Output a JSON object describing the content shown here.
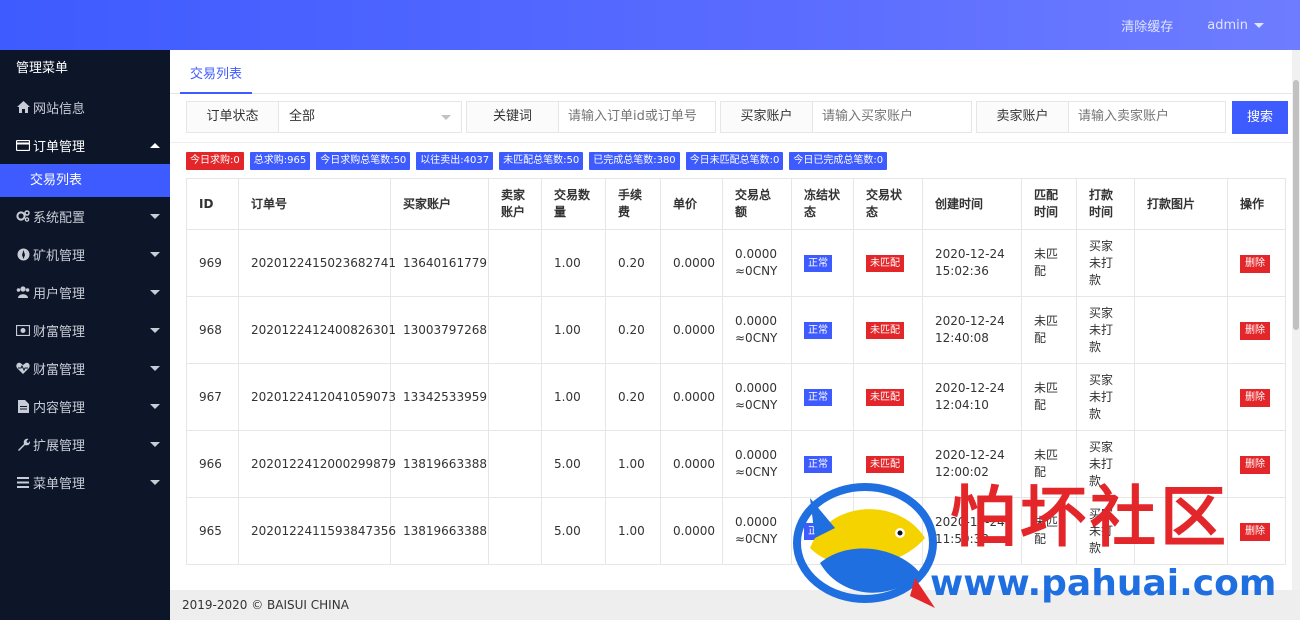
{
  "header": {
    "clear_cache": "清除缓存",
    "user": "admin"
  },
  "sidebar": {
    "title": "管理菜单",
    "items": [
      {
        "label": "网站信息",
        "icon": "home-icon"
      },
      {
        "label": "订单管理",
        "icon": "card-icon"
      },
      {
        "label": "系统配置",
        "icon": "gears-icon"
      },
      {
        "label": "矿机管理",
        "icon": "jet-icon"
      },
      {
        "label": "用户管理",
        "icon": "users-icon"
      },
      {
        "label": "财富管理",
        "icon": "money-icon"
      },
      {
        "label": "财富管理",
        "icon": "heartbeat-icon"
      },
      {
        "label": "内容管理",
        "icon": "file-icon"
      },
      {
        "label": "扩展管理",
        "icon": "wrench-icon"
      },
      {
        "label": "菜单管理",
        "icon": "bars-icon"
      }
    ],
    "sub_item": "交易列表"
  },
  "tab": "交易列表",
  "search": {
    "status_label": "订单状态",
    "status_value": "全部",
    "keyword_label": "关键词",
    "keyword_placeholder": "请输入订单id或订单号",
    "buyer_label": "买家账户",
    "buyer_placeholder": "请输入买家账户",
    "seller_label": "卖家账户",
    "seller_placeholder": "请输入卖家账户",
    "button": "搜索"
  },
  "badges": [
    {
      "text": "今日求购:0",
      "color": "#e3262a"
    },
    {
      "text": "总求购:965",
      "color": "#3e5bff"
    },
    {
      "text": "今日求购总笔数:50",
      "color": "#3e5bff"
    },
    {
      "text": "以往卖出:4037",
      "color": "#3e5bff"
    },
    {
      "text": "未匹配总笔数:50",
      "color": "#3e5bff"
    },
    {
      "text": "已完成总笔数:380",
      "color": "#3e5bff"
    },
    {
      "text": "今日未匹配总笔数:0",
      "color": "#3e5bff"
    },
    {
      "text": "今日已完成总笔数:0",
      "color": "#3e5bff"
    }
  ],
  "table": {
    "headers": [
      "ID",
      "订单号",
      "买家账户",
      "卖家账户",
      "交易数量",
      "手续费",
      "单价",
      "交易总额",
      "冻结状态",
      "交易状态",
      "创建时间",
      "匹配时间",
      "打款时间",
      "打款图片",
      "操作"
    ],
    "rows": [
      {
        "id": "969",
        "order": "2020122415023682741",
        "buyer": "13640161779",
        "seller": "",
        "qty": "1.00",
        "fee": "0.20",
        "price": "0.0000",
        "total1": "0.0000",
        "total2": "≈0CNY",
        "freeze": "正常",
        "status": "未匹配",
        "date": "2020-12-24",
        "time": "15:02:36",
        "match": "未匹配",
        "pay": "买家未打款",
        "img": "",
        "op": "删除"
      },
      {
        "id": "968",
        "order": "2020122412400826301",
        "buyer": "13003797268",
        "seller": "",
        "qty": "1.00",
        "fee": "0.20",
        "price": "0.0000",
        "total1": "0.0000",
        "total2": "≈0CNY",
        "freeze": "正常",
        "status": "未匹配",
        "date": "2020-12-24",
        "time": "12:40:08",
        "match": "未匹配",
        "pay": "买家未打款",
        "img": "",
        "op": "删除"
      },
      {
        "id": "967",
        "order": "2020122412041059073",
        "buyer": "13342533959",
        "seller": "",
        "qty": "1.00",
        "fee": "0.20",
        "price": "0.0000",
        "total1": "0.0000",
        "total2": "≈0CNY",
        "freeze": "正常",
        "status": "未匹配",
        "date": "2020-12-24",
        "time": "12:04:10",
        "match": "未匹配",
        "pay": "买家未打款",
        "img": "",
        "op": "删除"
      },
      {
        "id": "966",
        "order": "2020122412000299879",
        "buyer": "13819663388",
        "seller": "",
        "qty": "5.00",
        "fee": "1.00",
        "price": "0.0000",
        "total1": "0.0000",
        "total2": "≈0CNY",
        "freeze": "正常",
        "status": "未匹配",
        "date": "2020-12-24",
        "time": "12:00:02",
        "match": "未匹配",
        "pay": "买家未打款",
        "img": "",
        "op": "删除"
      },
      {
        "id": "965",
        "order": "2020122411593847356",
        "buyer": "13819663388",
        "seller": "",
        "qty": "5.00",
        "fee": "1.00",
        "price": "0.0000",
        "total1": "0.0000",
        "total2": "≈0CNY",
        "freeze": "正常",
        "status": "未匹配",
        "date": "2020-12-24",
        "time": "11:59:38",
        "match": "未匹配",
        "pay": "买家未打款",
        "img": "",
        "op": "删除"
      }
    ]
  },
  "footer": "2019-2020 © BAISUI CHINA",
  "watermark": {
    "text": "怕坏社区",
    "url": "www.pahuai.com"
  }
}
